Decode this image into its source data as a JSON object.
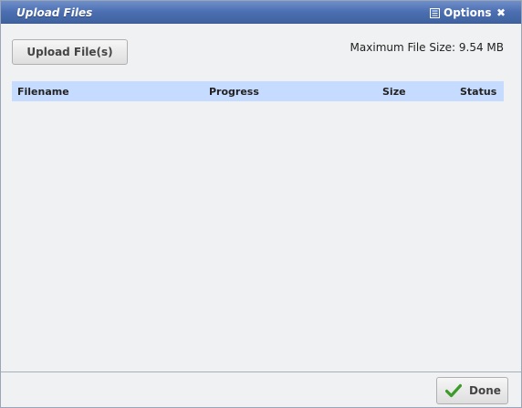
{
  "window": {
    "title": "Upload Files",
    "options_label": "Options",
    "close_glyph": "✖"
  },
  "toolbar": {
    "upload_label": "Upload File(s)",
    "max_file_size": "Maximum File Size: 9.54 MB"
  },
  "grid": {
    "columns": [
      "Filename",
      "Progress",
      "Size",
      "Status"
    ],
    "rows": []
  },
  "footer": {
    "done_label": "Done"
  },
  "icons": {
    "options": "list-icon",
    "done": "checkmark-icon"
  },
  "colors": {
    "titlebar": "#4c6fb2",
    "grid_header": "#c5dbff",
    "body_bg": "#eff1f3",
    "check_green": "#3d9a2b"
  }
}
